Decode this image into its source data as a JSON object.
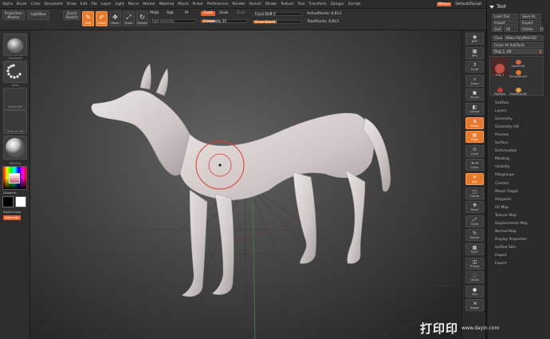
{
  "menubar": {
    "items": [
      "Alpha",
      "Brush",
      "Color",
      "Document",
      "Draw",
      "Edit",
      "File",
      "Layer",
      "Light",
      "Macro",
      "Marker",
      "Material",
      "Movie",
      "Picker",
      "Preferences",
      "Render",
      "Stencil",
      "Stroke",
      "Texture",
      "Tool",
      "Transform",
      "Zplugin",
      "Zscript"
    ],
    "tag": "Menus",
    "doc": "DefaultZScript"
  },
  "toolbar": {
    "projection_master": "Projection Master",
    "lightbox": "LightBox",
    "quick_sketch": "Quick Sketch",
    "tools": [
      {
        "id": "edit",
        "label": "Edit",
        "glyph": "✎",
        "active": true
      },
      {
        "id": "draw",
        "label": "Draw",
        "glyph": "✐",
        "active": true
      },
      {
        "id": "move",
        "label": "Move",
        "glyph": "✥",
        "active": false
      },
      {
        "id": "scale",
        "label": "Scale",
        "glyph": "⤢",
        "active": false
      },
      {
        "id": "rotate",
        "label": "Rotate",
        "glyph": "↻",
        "active": false
      }
    ],
    "mrgb": "Mrgb",
    "rgb": "Rgb",
    "m": "M",
    "rgb_intensity": "Rgb Intensity",
    "zadd": "Zadd",
    "zsub": "Zsub",
    "zcut": "Zcut",
    "z_intensity": "Z Intensity 25",
    "focal_shift": "Focal Shift 0",
    "draw_size": "Draw Size 64",
    "active_points": "ActivePoints: 9,813",
    "total_points": "TotalPoints: 9,813"
  },
  "leftshelf": {
    "brush_caption": "Standard",
    "stroke_caption": "Dots",
    "alpha_caption": "Alpha Off",
    "texture_caption": "Texture Off",
    "material_caption": "MatCap",
    "gradient": "Gradient",
    "switch_color": "SwitchColor",
    "alternate": "Alternate"
  },
  "rightshelf": {
    "buttons": [
      {
        "label": "BPR",
        "glyph": "◉",
        "active": false
      },
      {
        "label": "SPix",
        "glyph": "▦",
        "active": false
      },
      {
        "label": "Scroll",
        "glyph": "⇕",
        "active": false
      },
      {
        "label": "Zoom",
        "glyph": "⌕",
        "active": false
      },
      {
        "label": "Actual",
        "glyph": "▣",
        "active": false
      },
      {
        "label": "AAHalf",
        "glyph": "◧",
        "active": false
      },
      {
        "label": "Persp",
        "glyph": "⧈",
        "active": true
      },
      {
        "label": "Floor",
        "glyph": "▤",
        "active": true
      },
      {
        "label": "Local",
        "glyph": "⊙",
        "active": false
      },
      {
        "label": "LSym",
        "glyph": "⟷",
        "active": false
      },
      {
        "label": "Xyz",
        "glyph": "✳",
        "active": true
      },
      {
        "label": "Frame",
        "glyph": "▢",
        "active": false
      },
      {
        "label": "Move",
        "glyph": "✥",
        "active": false
      },
      {
        "label": "Scale",
        "glyph": "⤢",
        "active": false
      },
      {
        "label": "Rotate",
        "glyph": "↻",
        "active": false
      },
      {
        "label": "PolyF",
        "glyph": "▩",
        "active": false
      },
      {
        "label": "Transp",
        "glyph": "◫",
        "active": false
      },
      {
        "label": "Ghost",
        "glyph": "◌",
        "active": false
      },
      {
        "label": "Solo",
        "glyph": "●",
        "active": false
      },
      {
        "label": "Xpose",
        "glyph": "⇲",
        "active": false
      }
    ]
  },
  "palette": {
    "title": "Tool",
    "load_tool": "Load Tool",
    "save_as": "Save As",
    "import": "Import",
    "export": "Export",
    "goz": "GoZ",
    "all": "All",
    "visible": "Visible",
    "r": "R",
    "clone": "Clone",
    "make_polymesh": "Make PolyMesh3D",
    "clone_all": "Clone All SubTools",
    "current_tool": "Dog_1. 48",
    "subtools": [
      {
        "label": "Dog_1",
        "color": "#c0504a"
      },
      {
        "label": "Sphere3D",
        "color": "#d9653a"
      },
      {
        "label": "SimpleBrush",
        "color": "#e0772f"
      },
      {
        "label": "ZSphere",
        "color": "#c23a2e"
      },
      {
        "label": "PolyMesh3D",
        "color": "#e8a03a"
      }
    ],
    "menu": [
      "SubTool",
      "Layers",
      "Geometry",
      "Geometry HD",
      "Preview",
      "Surface",
      "Deformation",
      "Masking",
      "Visibility",
      "Polygroups",
      "Contact",
      "Morph Target",
      "Polypaint",
      "UV Map",
      "Texture Map",
      "Displacement Map",
      "Normal Map",
      "Display Properties",
      "Unified Skin",
      "Import",
      "Export"
    ]
  },
  "watermark": {
    "brand": "打印印",
    "url": "www.dayin.com"
  },
  "colors": {
    "accent": "#e8782a",
    "brush_ring": "#e23a2a",
    "model": "#d6cfcd"
  }
}
